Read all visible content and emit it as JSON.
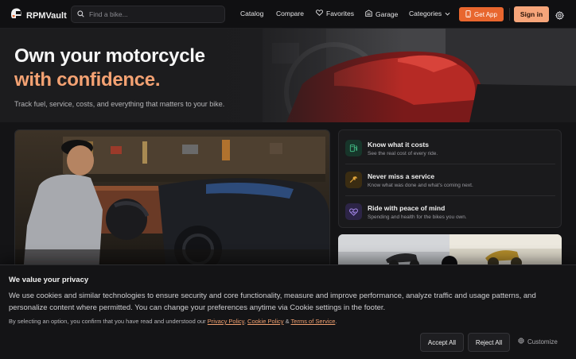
{
  "brand": {
    "name": "RPMVault",
    "icon": "helmet-logo-icon"
  },
  "search": {
    "placeholder": "Find a bike...",
    "value": ""
  },
  "nav": {
    "catalog": "Catalog",
    "compare": "Compare",
    "favorites": "Favorites",
    "garage": "Garage",
    "categories": "Categories",
    "get_app": "Get App",
    "sign_in": "Sign in"
  },
  "hero": {
    "title_line1": "Own your motorcycle",
    "title_line2": "with confidence.",
    "subtitle": "Track fuel, service, costs, and everything that matters to your bike."
  },
  "features": [
    {
      "title": "Know what it costs",
      "desc": "See the real cost of every ride.",
      "icon": "fuel-pump-icon",
      "color": "#3fb27f"
    },
    {
      "title": "Never miss a service",
      "desc": "Know what was done and what's coming next.",
      "icon": "wrench-icon",
      "color": "#e0a43a"
    },
    {
      "title": "Ride with peace of mind",
      "desc": "Spending and health for the bikes you own.",
      "icon": "heart-pulse-icon",
      "color": "#a98bf0"
    }
  ],
  "cookie": {
    "title": "We value your privacy",
    "body": "We use cookies and similar technologies to ensure security and core functionality, measure and improve performance, analyze traffic and usage patterns, and personalize content where permitted. You can change your preferences anytime via Cookie settings in the footer.",
    "consent_prefix": "By selecting an option, you confirm that you have read and understood our ",
    "privacy_policy": "Privacy Policy",
    "sep1": ", ",
    "cookie_policy": "Cookie Policy",
    "sep2": " & ",
    "terms": "Terms of Service",
    "suffix": ".",
    "accept_all": "Accept All",
    "reject_all": "Reject All",
    "customize": "Customize"
  },
  "colors": {
    "accent": "#e8662e",
    "accent_light": "#f6a57a",
    "hero_highlight": "#f4a273"
  }
}
